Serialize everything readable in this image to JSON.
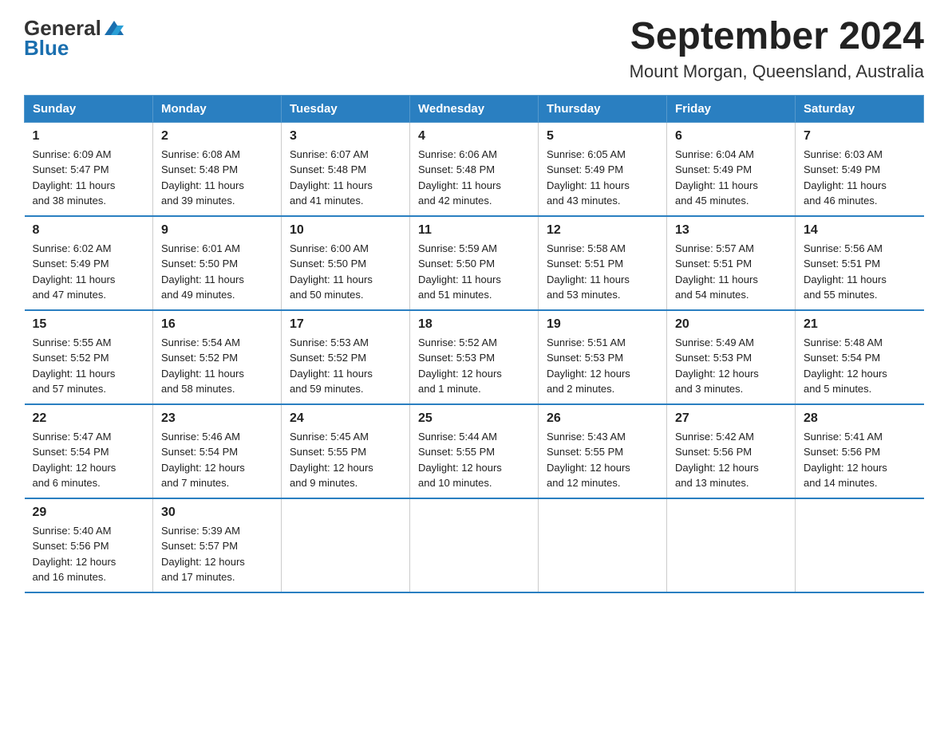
{
  "logo": {
    "general": "General",
    "blue": "Blue"
  },
  "title": "September 2024",
  "subtitle": "Mount Morgan, Queensland, Australia",
  "days_header": [
    "Sunday",
    "Monday",
    "Tuesday",
    "Wednesday",
    "Thursday",
    "Friday",
    "Saturday"
  ],
  "weeks": [
    [
      {
        "day": "1",
        "sunrise": "6:09 AM",
        "sunset": "5:47 PM",
        "daylight": "11 hours and 38 minutes."
      },
      {
        "day": "2",
        "sunrise": "6:08 AM",
        "sunset": "5:48 PM",
        "daylight": "11 hours and 39 minutes."
      },
      {
        "day": "3",
        "sunrise": "6:07 AM",
        "sunset": "5:48 PM",
        "daylight": "11 hours and 41 minutes."
      },
      {
        "day": "4",
        "sunrise": "6:06 AM",
        "sunset": "5:48 PM",
        "daylight": "11 hours and 42 minutes."
      },
      {
        "day": "5",
        "sunrise": "6:05 AM",
        "sunset": "5:49 PM",
        "daylight": "11 hours and 43 minutes."
      },
      {
        "day": "6",
        "sunrise": "6:04 AM",
        "sunset": "5:49 PM",
        "daylight": "11 hours and 45 minutes."
      },
      {
        "day": "7",
        "sunrise": "6:03 AM",
        "sunset": "5:49 PM",
        "daylight": "11 hours and 46 minutes."
      }
    ],
    [
      {
        "day": "8",
        "sunrise": "6:02 AM",
        "sunset": "5:49 PM",
        "daylight": "11 hours and 47 minutes."
      },
      {
        "day": "9",
        "sunrise": "6:01 AM",
        "sunset": "5:50 PM",
        "daylight": "11 hours and 49 minutes."
      },
      {
        "day": "10",
        "sunrise": "6:00 AM",
        "sunset": "5:50 PM",
        "daylight": "11 hours and 50 minutes."
      },
      {
        "day": "11",
        "sunrise": "5:59 AM",
        "sunset": "5:50 PM",
        "daylight": "11 hours and 51 minutes."
      },
      {
        "day": "12",
        "sunrise": "5:58 AM",
        "sunset": "5:51 PM",
        "daylight": "11 hours and 53 minutes."
      },
      {
        "day": "13",
        "sunrise": "5:57 AM",
        "sunset": "5:51 PM",
        "daylight": "11 hours and 54 minutes."
      },
      {
        "day": "14",
        "sunrise": "5:56 AM",
        "sunset": "5:51 PM",
        "daylight": "11 hours and 55 minutes."
      }
    ],
    [
      {
        "day": "15",
        "sunrise": "5:55 AM",
        "sunset": "5:52 PM",
        "daylight": "11 hours and 57 minutes."
      },
      {
        "day": "16",
        "sunrise": "5:54 AM",
        "sunset": "5:52 PM",
        "daylight": "11 hours and 58 minutes."
      },
      {
        "day": "17",
        "sunrise": "5:53 AM",
        "sunset": "5:52 PM",
        "daylight": "11 hours and 59 minutes."
      },
      {
        "day": "18",
        "sunrise": "5:52 AM",
        "sunset": "5:53 PM",
        "daylight": "12 hours and 1 minute."
      },
      {
        "day": "19",
        "sunrise": "5:51 AM",
        "sunset": "5:53 PM",
        "daylight": "12 hours and 2 minutes."
      },
      {
        "day": "20",
        "sunrise": "5:49 AM",
        "sunset": "5:53 PM",
        "daylight": "12 hours and 3 minutes."
      },
      {
        "day": "21",
        "sunrise": "5:48 AM",
        "sunset": "5:54 PM",
        "daylight": "12 hours and 5 minutes."
      }
    ],
    [
      {
        "day": "22",
        "sunrise": "5:47 AM",
        "sunset": "5:54 PM",
        "daylight": "12 hours and 6 minutes."
      },
      {
        "day": "23",
        "sunrise": "5:46 AM",
        "sunset": "5:54 PM",
        "daylight": "12 hours and 7 minutes."
      },
      {
        "day": "24",
        "sunrise": "5:45 AM",
        "sunset": "5:55 PM",
        "daylight": "12 hours and 9 minutes."
      },
      {
        "day": "25",
        "sunrise": "5:44 AM",
        "sunset": "5:55 PM",
        "daylight": "12 hours and 10 minutes."
      },
      {
        "day": "26",
        "sunrise": "5:43 AM",
        "sunset": "5:55 PM",
        "daylight": "12 hours and 12 minutes."
      },
      {
        "day": "27",
        "sunrise": "5:42 AM",
        "sunset": "5:56 PM",
        "daylight": "12 hours and 13 minutes."
      },
      {
        "day": "28",
        "sunrise": "5:41 AM",
        "sunset": "5:56 PM",
        "daylight": "12 hours and 14 minutes."
      }
    ],
    [
      {
        "day": "29",
        "sunrise": "5:40 AM",
        "sunset": "5:56 PM",
        "daylight": "12 hours and 16 minutes."
      },
      {
        "day": "30",
        "sunrise": "5:39 AM",
        "sunset": "5:57 PM",
        "daylight": "12 hours and 17 minutes."
      },
      null,
      null,
      null,
      null,
      null
    ]
  ],
  "labels": {
    "sunrise": "Sunrise:",
    "sunset": "Sunset:",
    "daylight": "Daylight:"
  }
}
